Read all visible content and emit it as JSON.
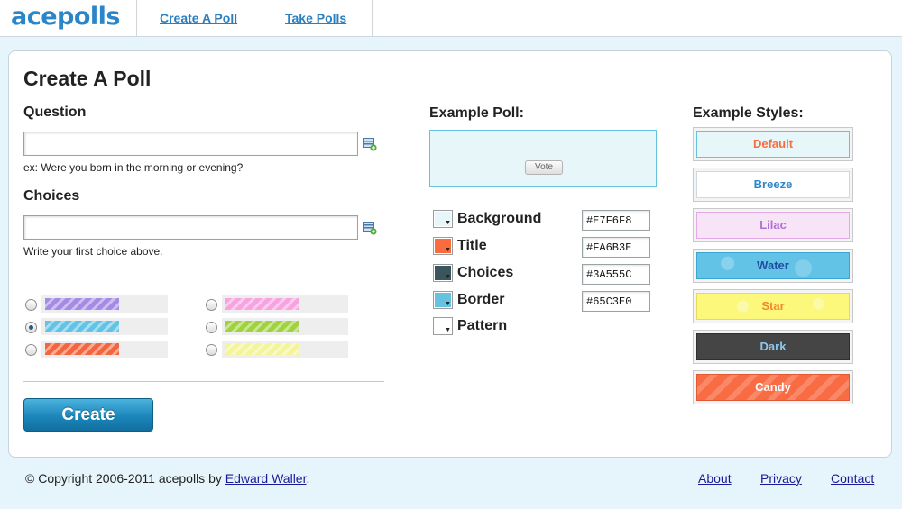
{
  "header": {
    "logo": "acepolls",
    "nav": [
      {
        "label": "Create A Poll"
      },
      {
        "label": "Take Polls"
      }
    ]
  },
  "main": {
    "title": "Create A Poll",
    "question": {
      "label": "Question",
      "value": "",
      "hint": "ex: Were you born in the morning or evening?"
    },
    "choices": {
      "label": "Choices",
      "value": "",
      "hint": "Write your first choice above."
    },
    "color_options": [
      {
        "color": "#a58be6",
        "selected": false
      },
      {
        "color": "#62c3e6",
        "selected": true
      },
      {
        "color": "#f2653e",
        "selected": false
      },
      {
        "color": "#f7a3e0",
        "selected": false
      },
      {
        "color": "#9fd23e",
        "selected": false
      },
      {
        "color": "#f4f49a",
        "selected": false
      }
    ],
    "create_button": "Create"
  },
  "example_poll": {
    "label": "Example Poll:",
    "vote_button": "Vote",
    "background": "#E7F6F8",
    "border": "#65C3E0"
  },
  "colors": [
    {
      "label": "Background",
      "hex": "#E7F6F8",
      "swatch": "#E7F6F8"
    },
    {
      "label": "Title",
      "hex": "#FA6B3E",
      "swatch": "#FA6B3E"
    },
    {
      "label": "Choices",
      "hex": "#3A555C",
      "swatch": "#3A555C"
    },
    {
      "label": "Border",
      "hex": "#65C3E0",
      "swatch": "#65C3E0"
    },
    {
      "label": "Pattern",
      "hex": "",
      "swatch": "#ffffff"
    }
  ],
  "example_styles": {
    "label": "Example Styles:",
    "items": [
      {
        "label": "Default",
        "bg": "#e7f6f8",
        "border": "#65c3e0",
        "text": "#fa6b3e"
      },
      {
        "label": "Breeze",
        "bg": "#ffffff",
        "border": "#cfd8dc",
        "text": "#2a86c8"
      },
      {
        "label": "Lilac",
        "bg": "#f7e4f7",
        "border": "#e2a9e6",
        "text": "#b06fd6"
      },
      {
        "label": "Water",
        "bg": "#62c3e6",
        "border": "#3aa5d0",
        "text": "#1f4fa0"
      },
      {
        "label": "Star",
        "bg": "#fbf87c",
        "border": "#e7d95a",
        "text": "#f08a2b"
      },
      {
        "label": "Dark",
        "bg": "#454545",
        "border": "#2f2f2f",
        "text": "#8cc7ef"
      },
      {
        "label": "Candy",
        "bg": "#f86b43",
        "border": "#e05a33",
        "text": "#ffffff"
      }
    ]
  },
  "footer": {
    "copyright": "© Copyright 2006-2011 acepolls by ",
    "author": "Edward Waller",
    "period": ".",
    "links": [
      {
        "label": "About"
      },
      {
        "label": "Privacy"
      },
      {
        "label": "Contact"
      }
    ]
  }
}
